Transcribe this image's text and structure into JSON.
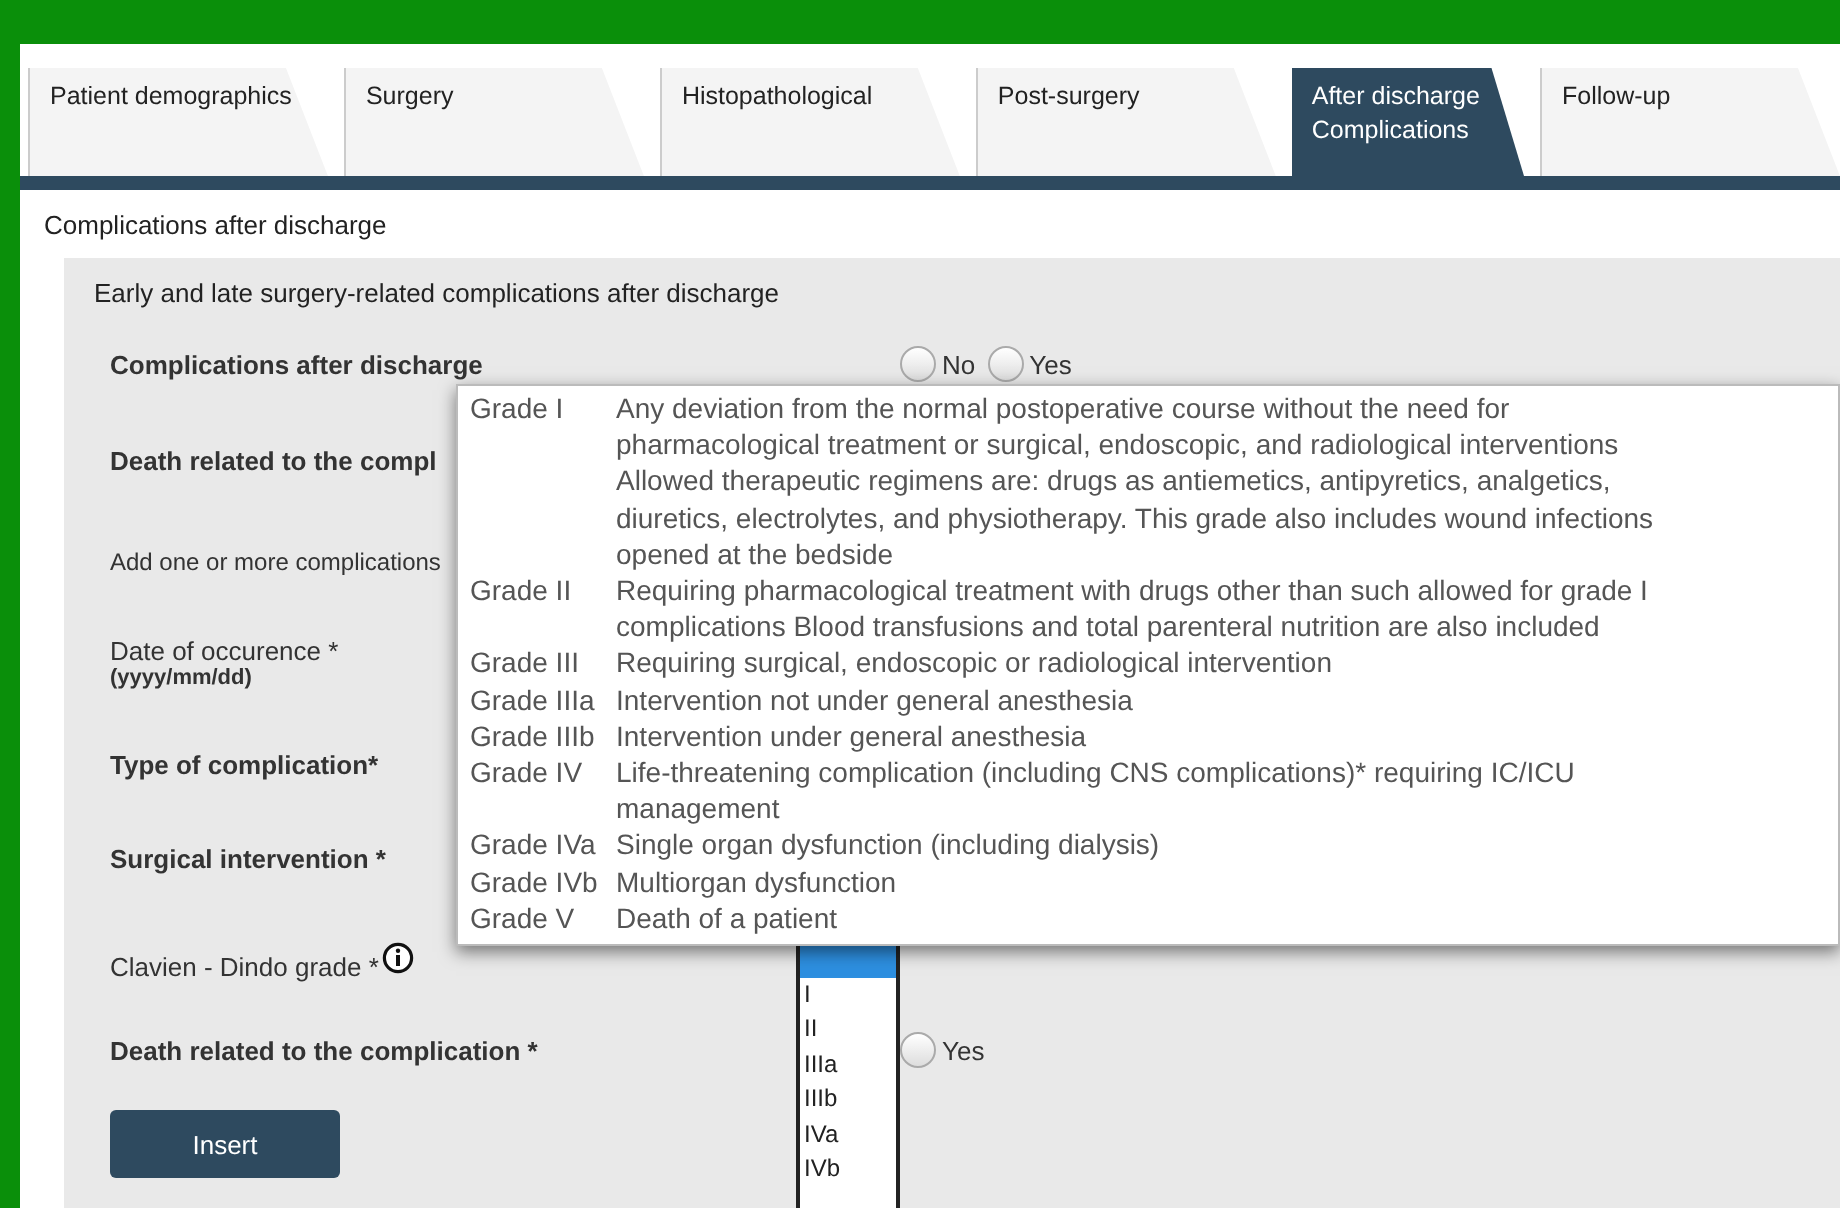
{
  "tabs": [
    {
      "label": "Patient demographics",
      "selected": false
    },
    {
      "label": "Surgery",
      "selected": false
    },
    {
      "label": "Histopathological",
      "selected": false
    },
    {
      "label": "Post-surgery",
      "selected": false
    },
    {
      "label": "After discharge\nComplications",
      "selected": true
    },
    {
      "label": "Follow-up",
      "selected": false
    }
  ],
  "section_title": "Complications after discharge",
  "form": {
    "title": "Early and late surgery-related complications after discharge",
    "rows": [
      {
        "kind": "radios",
        "label": "Complications after discharge",
        "options": [
          {
            "label": "No",
            "selected": false
          },
          {
            "label": "Yes",
            "selected": false
          }
        ]
      },
      {
        "kind": "field",
        "label": "Death related to the compl"
      },
      {
        "kind": "note",
        "label": "Add one or more complications"
      },
      {
        "kind": "date",
        "label": "Date of occurence *",
        "hint": "(yyyy/mm/dd)"
      },
      {
        "kind": "field",
        "label": "Type of complication*"
      },
      {
        "kind": "field",
        "label": "Surgical intervention *"
      },
      {
        "kind": "listbox",
        "label": "Clavien - Dindo grade *",
        "info": true,
        "options": [
          {
            "selected": true
          },
          {
            "label": "I",
            "selected": false
          },
          {
            "label": "II",
            "selected": false
          },
          {
            "label": "IIIa",
            "selected": false
          },
          {
            "label": "IIIb",
            "selected": false
          },
          {
            "label": "IVa",
            "selected": false
          },
          {
            "label": "IVb",
            "selected": false
          }
        ]
      },
      {
        "kind": "radios",
        "label": "Death related to the complication *",
        "options": [
          {
            "label": "Yes",
            "selected": false
          }
        ]
      }
    ],
    "button": "Insert"
  },
  "tooltip": [
    {
      "grade": "Grade I",
      "lines": [
        "Any deviation from the normal postoperative course without the need for",
        "pharmacological treatment or surgical, endoscopic, and radiological interventions",
        "Allowed therapeutic regimens are: drugs as antiemetics, antipyretics, analgetics,",
        "diuretics, electrolytes, and physiotherapy. This grade also includes wound infections",
        "opened at the bedside"
      ]
    },
    {
      "grade": "Grade II",
      "lines": [
        "Requiring pharmacological treatment with drugs other than such allowed for grade I",
        "complications Blood transfusions and total parenteral nutrition are also included"
      ]
    },
    {
      "grade": "Grade III",
      "lines": [
        "Requiring surgical, endoscopic or radiological intervention"
      ]
    },
    {
      "grade": "Grade IIIa",
      "lines": [
        "Intervention not under general anesthesia"
      ]
    },
    {
      "grade": "Grade IIIb",
      "lines": [
        "Intervention under general anesthesia"
      ]
    },
    {
      "grade": "Grade IV",
      "lines": [
        "Life-threatening complication (including CNS complications)* requiring IC/ICU",
        "management"
      ]
    },
    {
      "grade": "Grade IVa",
      "lines": [
        "Single organ dysfunction (including dialysis)"
      ]
    },
    {
      "grade": "Grade IVb",
      "lines": [
        "Multiorgan dysfunction"
      ]
    },
    {
      "grade": "Grade V",
      "lines": [
        "Death of a patient"
      ]
    }
  ]
}
